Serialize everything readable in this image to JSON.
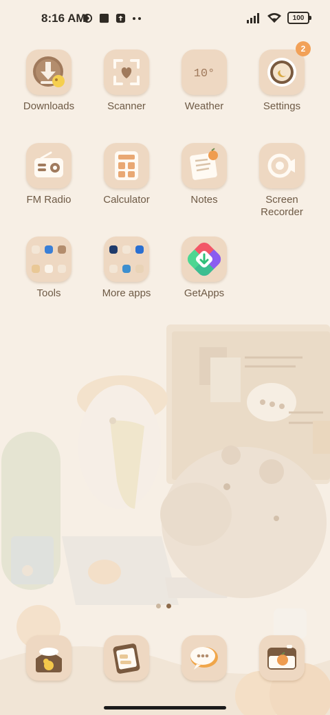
{
  "status_bar": {
    "time": "8:16 AM",
    "battery_level": "100",
    "left_icons": [
      "vpn-icon",
      "notification-square-icon",
      "upload-icon",
      "more-dots-icon"
    ],
    "right_icons": [
      "signal-icon",
      "wifi-icon",
      "battery-icon"
    ]
  },
  "home": {
    "rows": [
      [
        {
          "label": "Downloads",
          "icon": "download-icon"
        },
        {
          "label": "Scanner",
          "icon": "scanner-icon"
        },
        {
          "label": "Weather",
          "icon": "weather-icon",
          "icon_text": "10°"
        },
        {
          "label": "Settings",
          "icon": "settings-icon",
          "badge": "2"
        }
      ],
      [
        {
          "label": "FM Radio",
          "icon": "radio-icon"
        },
        {
          "label": "Calculator",
          "icon": "calculator-icon"
        },
        {
          "label": "Notes",
          "icon": "notes-icon"
        },
        {
          "label": "Screen\nRecorder",
          "icon": "screen-recorder-icon"
        }
      ],
      [
        {
          "label": "Tools",
          "icon": "folder-icon"
        },
        {
          "label": "More apps",
          "icon": "folder-icon"
        },
        {
          "label": "GetApps",
          "icon": "getapps-icon"
        }
      ]
    ]
  },
  "page_indicator": {
    "pages": 2,
    "current": 2
  },
  "dock": {
    "apps": [
      "phone-icon",
      "gallery-icon",
      "messages-icon",
      "camera-icon"
    ]
  },
  "colors": {
    "background": "#f7efe5",
    "icon_bg": "#eed8c2",
    "label": "#6e5a45",
    "badge": "#f2a158"
  }
}
